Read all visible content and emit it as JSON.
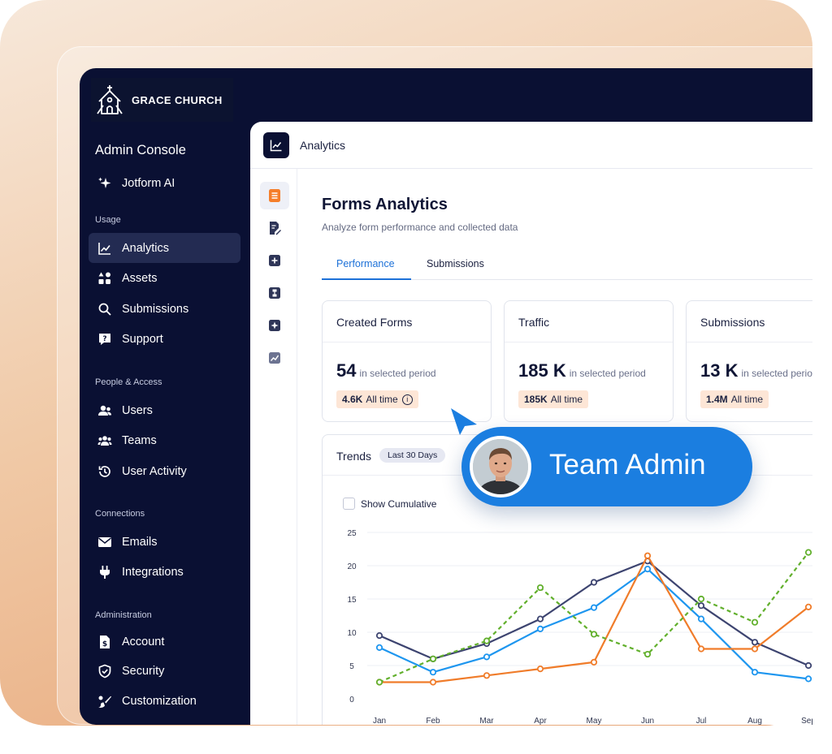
{
  "brand": {
    "name": "GRACE CHURCH"
  },
  "sidebar": {
    "title": "Admin Console",
    "ai_item": "Jotform AI",
    "sections": [
      {
        "label": "Usage",
        "items": [
          "Analytics",
          "Assets",
          "Submissions",
          "Support"
        ]
      },
      {
        "label": "People & Access",
        "items": [
          "Users",
          "Teams",
          "User Activity"
        ]
      },
      {
        "label": "Connections",
        "items": [
          "Emails",
          "Integrations"
        ]
      },
      {
        "label": "Administration",
        "items": [
          "Account",
          "Security",
          "Customization"
        ]
      }
    ],
    "active_item": "Analytics"
  },
  "header": {
    "title": "Analytics"
  },
  "page": {
    "title": "Forms Analytics",
    "subtitle": "Analyze form performance and collected data",
    "tabs": [
      "Performance",
      "Submissions"
    ],
    "active_tab": "Performance"
  },
  "stats": [
    {
      "title": "Created Forms",
      "value": "54",
      "unit": "",
      "period": "in selected period",
      "all_time_value": "4.6K",
      "all_time_label": "All time",
      "info_icon": "i"
    },
    {
      "title": "Traffic",
      "value": "185",
      "unit": "K",
      "period": "in selected period",
      "all_time_value": "185K",
      "all_time_label": "All time"
    },
    {
      "title": "Submissions",
      "value": "13",
      "unit": "K",
      "period": "in selected period",
      "all_time_value": "1.4M",
      "all_time_label": "All time"
    }
  ],
  "trends": {
    "title": "Trends",
    "range_pill": "Last 30 Days",
    "cumulative_label": "Show Cumulative"
  },
  "badge": {
    "label": "Team Admin"
  },
  "colors": {
    "sidebar": "#0a1033",
    "accent": "#1b7ee0",
    "badge_bg": "#fde6d6"
  },
  "chart_data": {
    "type": "line",
    "categories": [
      "Jan",
      "Feb",
      "Mar",
      "Apr",
      "May",
      "Jun",
      "Jul",
      "Aug",
      "Sep"
    ],
    "ylim": [
      0,
      25
    ],
    "yticks": [
      "0",
      "5",
      "10",
      "15",
      "20",
      "25"
    ],
    "grid": true,
    "series": [
      {
        "color": "#3d4470",
        "dashed": false,
        "values": [
          9.5,
          6,
          8.3,
          12,
          17.5,
          20.7,
          14,
          8.5,
          5
        ]
      },
      {
        "color": "#1e96ef",
        "dashed": false,
        "values": [
          7.7,
          4,
          6.3,
          10.5,
          13.7,
          19.5,
          12,
          4,
          3
        ]
      },
      {
        "color": "#f07c2a",
        "dashed": false,
        "values": [
          2.5,
          2.5,
          3.5,
          4.5,
          5.5,
          21.5,
          7.5,
          7.5,
          13.8
        ]
      },
      {
        "color": "#62b02d",
        "dashed": true,
        "values": [
          2.5,
          6,
          8.7,
          16.7,
          9.7,
          6.7,
          15,
          11.5,
          22
        ]
      }
    ]
  }
}
